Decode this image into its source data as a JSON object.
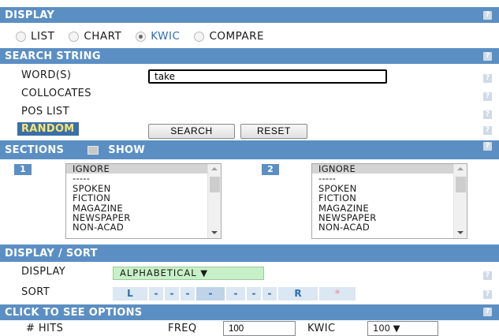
{
  "display_section": {
    "title": "DISPLAY",
    "options": [
      {
        "label": "LIST",
        "selected": false
      },
      {
        "label": "CHART",
        "selected": false
      },
      {
        "label": "KWIC",
        "selected": true
      },
      {
        "label": "COMPARE",
        "selected": false
      }
    ]
  },
  "search_section": {
    "title": "SEARCH STRING",
    "words_label": "WORD(S)",
    "words_value": "take",
    "collocates_label": "COLLOCATES",
    "pos_label": "POS LIST",
    "random_label": "RANDOM",
    "search_button": "SEARCH",
    "reset_button": "RESET"
  },
  "sections": {
    "title": "SECTIONS",
    "show_label": "SHOW",
    "list1_num": "1",
    "list2_num": "2",
    "items": [
      "IGNORE",
      "-----",
      "SPOKEN",
      "FICTION",
      "MAGAZINE",
      "NEWSPAPER",
      "NON-ACAD"
    ]
  },
  "display_sort": {
    "title": "DISPLAY / SORT",
    "display_label": "DISPLAY",
    "display_value": "ALPHABETICAL ▼",
    "sort_label": "SORT",
    "sort_cells": [
      "L",
      "-",
      "-",
      "-",
      "-",
      "-",
      "-",
      "-",
      "R",
      "*"
    ]
  },
  "options_bar": {
    "title": "CLICK TO SEE OPTIONS",
    "hits_label": "# HITS",
    "freq_label": "FREQ",
    "freq_value": "100",
    "kwic_label": "KWIC",
    "kwic_value": "100 ▼"
  },
  "help_glyph": "?",
  "colors": {
    "bar": "#5b8fc4",
    "random_bg": "#3a6fa8",
    "random_text": "#ffe66b",
    "display_select": "#c8f0c8",
    "sort_cell": "#dbe7f2",
    "link_blue": "#2d6bb5"
  }
}
